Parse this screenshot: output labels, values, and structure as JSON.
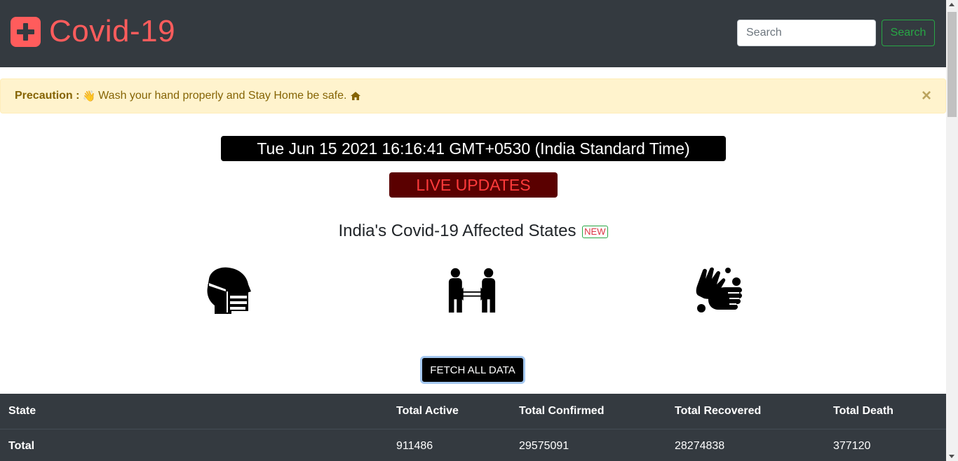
{
  "navbar": {
    "brand_icon": "plus-square-icon",
    "brand_text": "Covid-19",
    "search_placeholder": "Search",
    "search_button": "Search"
  },
  "alert": {
    "label": "Precaution :",
    "hand_icon": "hand-wash-icon",
    "message": "Wash your hand properly and Stay Home be safe.",
    "home_icon": "home-icon",
    "close": "×"
  },
  "datetime": "Tue Jun 15 2021 16:16:41 GMT+0530 (India Standard Time)",
  "live": "LIVE UPDATES",
  "heading": {
    "text": "India's Covid-19 Affected States",
    "badge": "NEW"
  },
  "icons": [
    "head-mask-icon",
    "social-distance-icon",
    "hands-wash-icon"
  ],
  "fetch_button": "FETCH ALL DATA",
  "table": {
    "headers": [
      "State",
      "Total Active",
      "Total Confirmed",
      "Total Recovered",
      "Total Death"
    ],
    "rows": [
      [
        "Total",
        "911486",
        "29575091",
        "28274838",
        "377120"
      ]
    ]
  },
  "colors": {
    "navbar_bg": "#343a40",
    "brand": "#ff5c5c",
    "search_green": "#28a745",
    "alert_bg": "#fff3cd",
    "alert_text": "#856404",
    "live_bg": "#5a0000",
    "live_text": "#ff3b3b"
  }
}
